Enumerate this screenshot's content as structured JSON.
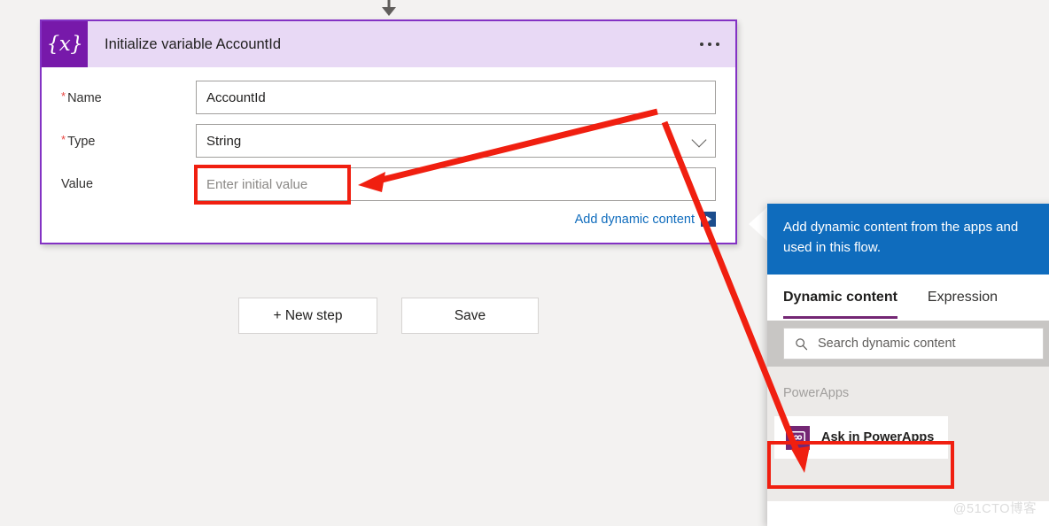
{
  "card": {
    "icon_glyph": "{x}",
    "title": "Initialize variable AccountId",
    "menu": "more-options",
    "fields": [
      {
        "label": "Name",
        "required": true,
        "value": "AccountId",
        "is_placeholder": false,
        "control": "text"
      },
      {
        "label": "Type",
        "required": true,
        "value": "String",
        "is_placeholder": false,
        "control": "dropdown"
      },
      {
        "label": "Value",
        "required": false,
        "value": "Enter initial value",
        "is_placeholder": true,
        "control": "text"
      }
    ],
    "add_dynamic_content_label": "Add dynamic content"
  },
  "buttons": {
    "new_step": "+ New step",
    "save": "Save"
  },
  "flyout": {
    "banner": "Add dynamic content from the apps and\nused in this flow.",
    "tabs": [
      {
        "label": "Dynamic content",
        "active": true
      },
      {
        "label": "Expression",
        "active": false
      }
    ],
    "search_placeholder": "Search dynamic content",
    "group_label": "PowerApps",
    "items": [
      {
        "label": "Ask in PowerApps",
        "icon": "powerapps-icon"
      }
    ]
  },
  "watermark": "@51CTO博客",
  "colors": {
    "accent_purple": "#7719AA",
    "card_border": "#8332C4",
    "header_lavender": "#E8D9F5",
    "link_blue": "#0F6CBD",
    "banner_blue": "#0F6CBD",
    "tab_underline": "#742774",
    "annotation_red": "#F01F10",
    "canvas": "#F3F2F1"
  }
}
